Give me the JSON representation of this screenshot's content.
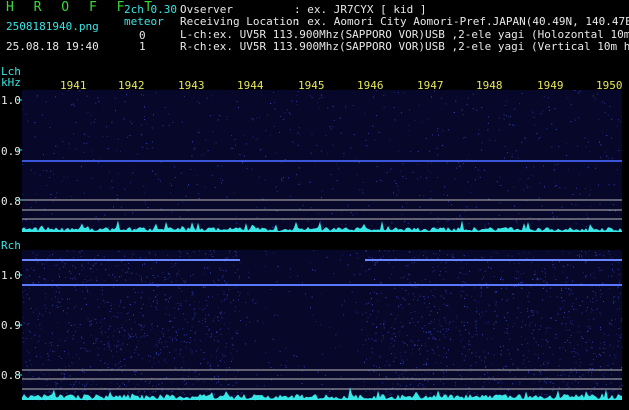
{
  "header": {
    "app_title": "H R O F F T",
    "version": "2ch 0.30",
    "filename": "2508181940.png",
    "datetime": "25.08.18 19:40",
    "meteor_label": "meteor",
    "meteor_lch_count": "0",
    "meteor_rch_count": "1",
    "observer_label": "Ovserver",
    "observer_value": ": ex. JR7CYX [ kid ]",
    "location_label": "Receiving Location",
    "location_value": ": ex. Aomori City Aomori-Pref.JAPAN(40.49N, 140.47E)",
    "lch_info": "L-ch:ex. UV5R 113.900Mhz(SAPPORO VOR)USB ,2-ele yagi (Holozontal 10m height)",
    "rch_info": "R-ch:ex. UV5R 113.900Mhz(SAPPORO VOR)USB ,2-ele yagi (Vertical 10m height)"
  },
  "lch_panel": {
    "label": "Lch",
    "unit": "kHz",
    "time_ticks": [
      "1941",
      "1942",
      "1943",
      "1944",
      "1945",
      "1946",
      "1947",
      "1948",
      "1949",
      "1950"
    ],
    "freq_ticks": [
      "1.0",
      "0.9",
      "0.8"
    ]
  },
  "rch_panel": {
    "label": "Rch",
    "freq_ticks": [
      "1.0",
      "0.9",
      "0.8"
    ]
  },
  "colors": {
    "label_cyan": "#39e6e6",
    "text_white": "#e8e8e8",
    "title_green": "#39d939",
    "tick_yellow": "#e8e85a",
    "noise_blue": "#1a1a8c",
    "echo_line": "#5a78ff"
  }
}
